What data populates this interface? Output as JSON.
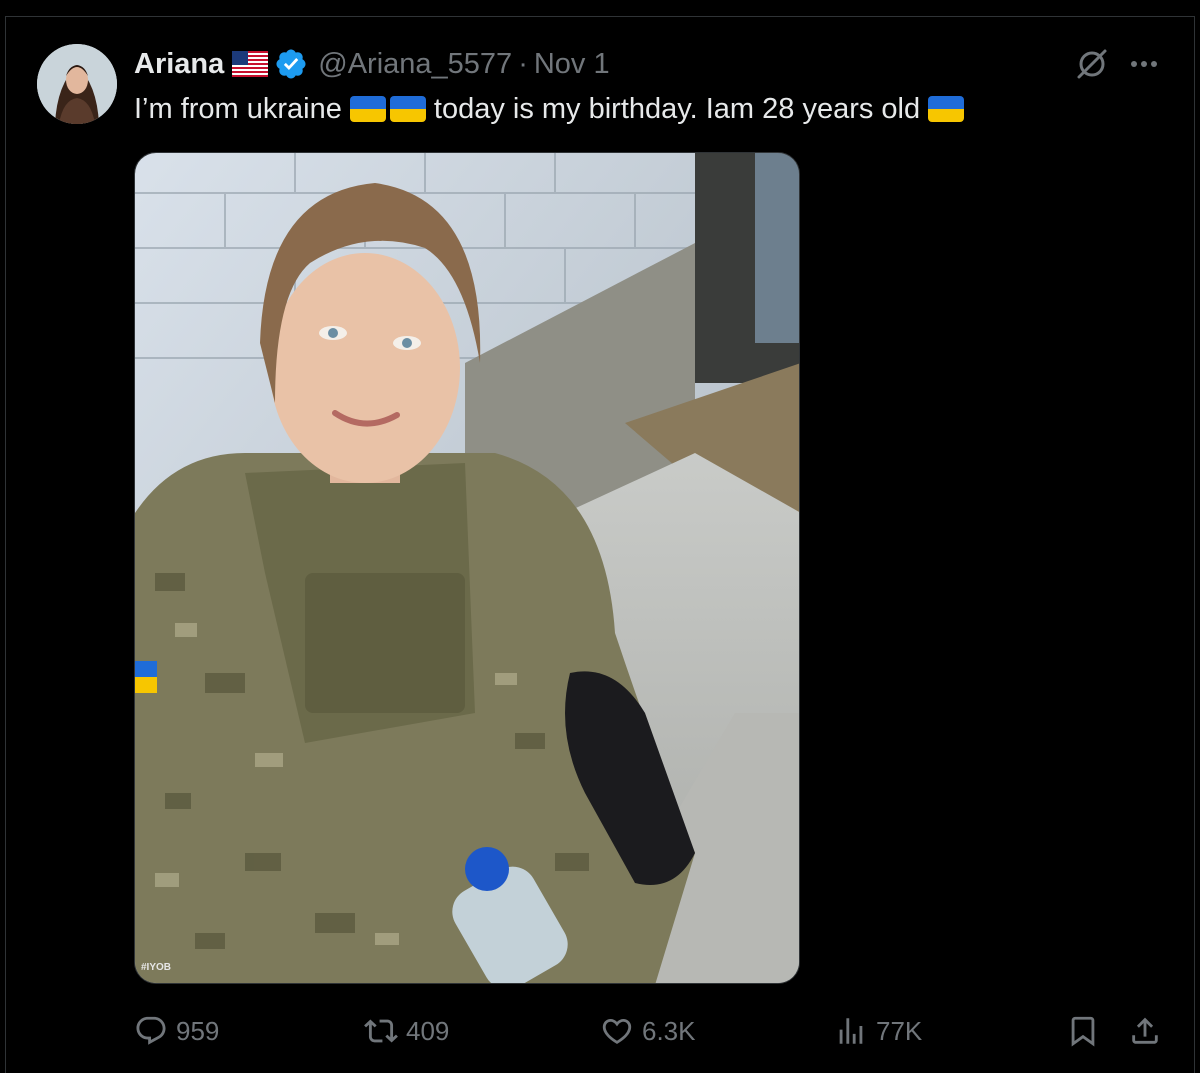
{
  "post": {
    "author_name": "Ariana",
    "handle": "@Ariana_5577",
    "separator": "·",
    "date": "Nov 1",
    "text_part1": "I’m from ukraine",
    "text_part2": "today is my birthday. Iam 28 years old",
    "media_watermark": "#IYOB"
  },
  "actions": {
    "replies": "959",
    "reposts": "409",
    "likes": "6.3K",
    "views": "77K"
  },
  "icons": [
    "grok-icon",
    "more-icon",
    "reply-icon",
    "repost-icon",
    "like-icon",
    "views-icon",
    "bookmark-icon",
    "share-icon",
    "verified-badge-icon",
    "us-flag-icon",
    "ukraine-flag-icon"
  ],
  "colors": {
    "background": "#000000",
    "text": "#e7e9ea",
    "muted": "#71767b",
    "verified": "#1d9bf0",
    "ua_blue": "#1f6cd8",
    "ua_yellow": "#f7c600"
  }
}
